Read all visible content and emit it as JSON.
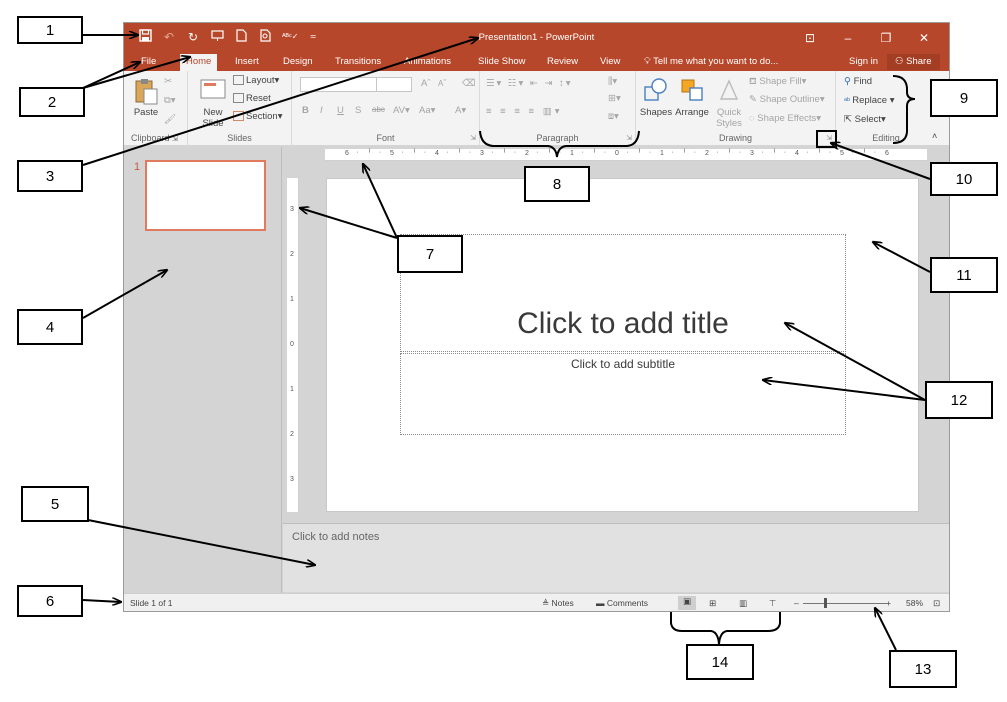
{
  "window": {
    "title": "Presentation1 - PowerPoint",
    "controls": [
      "⊡",
      "–",
      "❐",
      "✕"
    ]
  },
  "tabs": [
    "File",
    "Home",
    "Insert",
    "Design",
    "Transitions",
    "Animations",
    "Slide Show",
    "Review",
    "View"
  ],
  "active_tab": "Home",
  "tell_me": "Tell me what you want to do...",
  "sign_in": "Sign in",
  "share": "Share",
  "ribbon": {
    "clipboard": {
      "paste": "Paste",
      "label": "Clipboard"
    },
    "slides": {
      "new_slide_1": "New",
      "new_slide_2": "Slide",
      "layout": "Layout",
      "reset": "Reset",
      "section": "Section",
      "label": "Slides"
    },
    "font": {
      "bold": "B",
      "italic": "I",
      "underline": "U",
      "shadow": "S",
      "strike": "abc",
      "spacing": "AV",
      "case": "Aa",
      "grow": "A",
      "shrink": "A",
      "color": "A",
      "label": "Font"
    },
    "paragraph": {
      "label": "Paragraph"
    },
    "drawing": {
      "shapes": "Shapes",
      "arrange": "Arrange",
      "quick_styles_1": "Quick",
      "quick_styles_2": "Styles",
      "shape_fill": "Shape Fill",
      "shape_outline": "Shape Outline",
      "shape_effects": "Shape Effects",
      "label": "Drawing"
    },
    "editing": {
      "find": "Find",
      "replace": "Replace",
      "select": "Select",
      "label": "Editing"
    }
  },
  "slide_panel": {
    "slide_number": "1"
  },
  "slide": {
    "title_placeholder": "Click to add title",
    "subtitle_placeholder": "Click to add subtitle"
  },
  "notes_placeholder": "Click to add notes",
  "status": {
    "slide_info": "Slide 1 of 1",
    "notes": "Notes",
    "comments": "Comments",
    "zoom_minus": "–",
    "zoom_plus": "+",
    "zoom_level": "58%",
    "zoom_percent": 58
  },
  "callouts": [
    "1",
    "2",
    "3",
    "4",
    "5",
    "6",
    "7",
    "8",
    "9",
    "10",
    "11",
    "12",
    "13",
    "14"
  ]
}
